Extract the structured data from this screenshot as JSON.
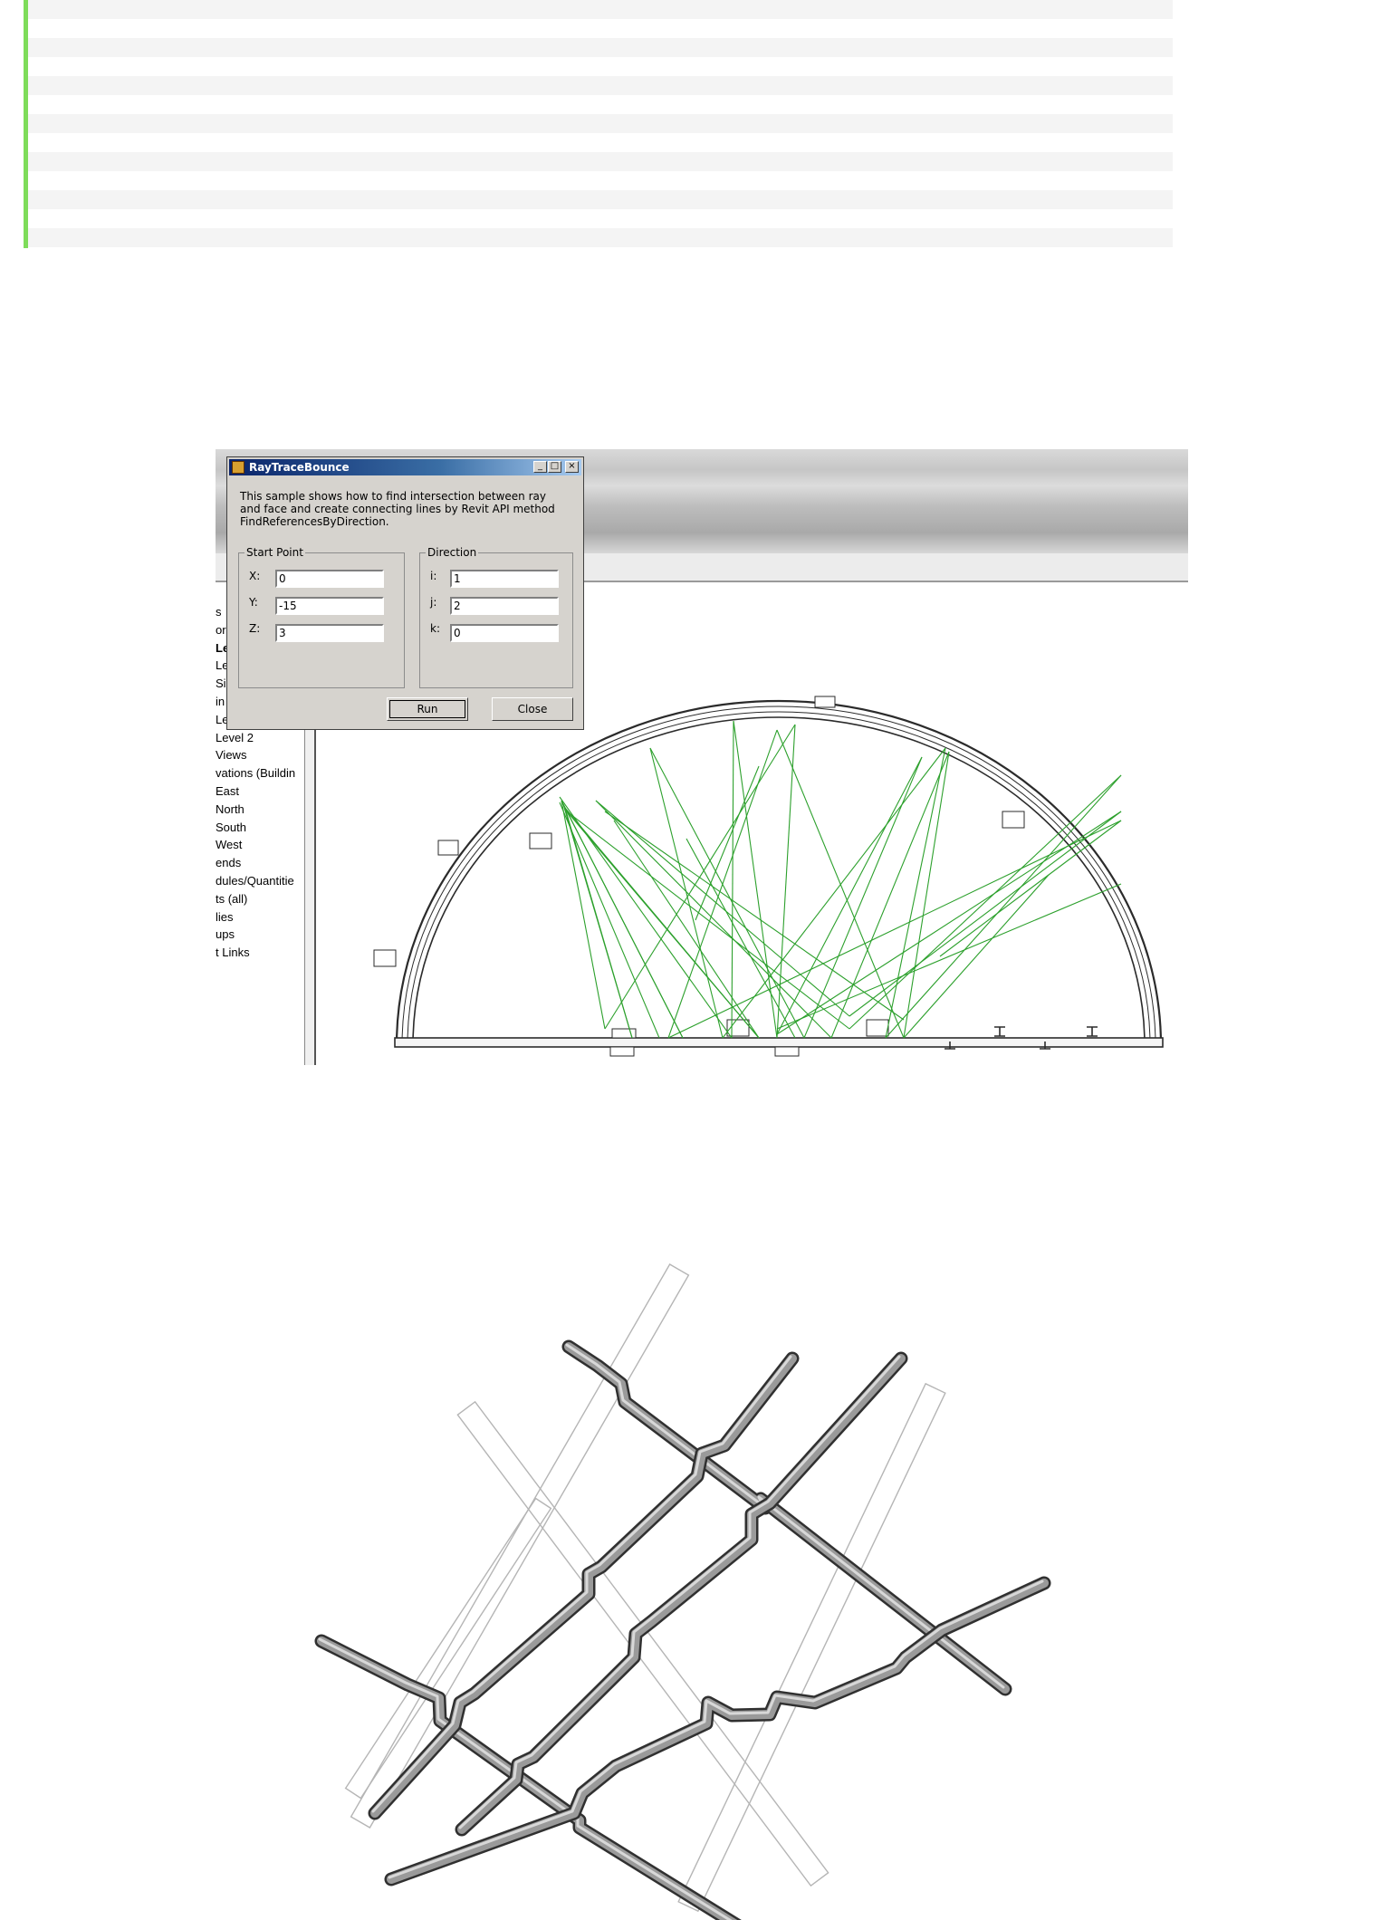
{
  "code_block": {
    "stripe_count": 13
  },
  "dialog": {
    "title": "RayTraceBounce",
    "minimize_label": "_",
    "maximize_label": "□",
    "close_label": "×",
    "description_lines": [
      "This sample shows how to find intersection between ray",
      "and face and create connecting lines by Revit API method",
      "FindReferencesByDirection."
    ],
    "start_point": {
      "legend": "Start Point",
      "x_label": "X:",
      "x_value": "0",
      "y_label": "Y:",
      "y_value": "-15",
      "z_label": "Z:",
      "z_value": "3"
    },
    "direction": {
      "legend": "Direction",
      "i_label": "i:",
      "i_value": "1",
      "j_label": "j:",
      "j_value": "2",
      "k_label": "k:",
      "k_value": "0"
    },
    "run_label": "Run",
    "close_button_label": "Close"
  },
  "project_browser": {
    "items": [
      "s",
      "or",
      "Le",
      "Le",
      "Si",
      "in",
      "Le",
      "Level 2",
      "Views",
      "vations (Buildin",
      "East",
      "North",
      "South",
      "West",
      "ends",
      "dules/Quantitie",
      "ts (all)",
      "lies",
      "ups",
      "t Links"
    ],
    "bold_index": 2
  },
  "colors": {
    "ray_lines": "#2ca02c",
    "wall_lines": "#2b2b2b",
    "pipe_fill": "#9a9a9a",
    "beam_lines": "#b5b5b5",
    "accent_border": "#7edc5a"
  }
}
